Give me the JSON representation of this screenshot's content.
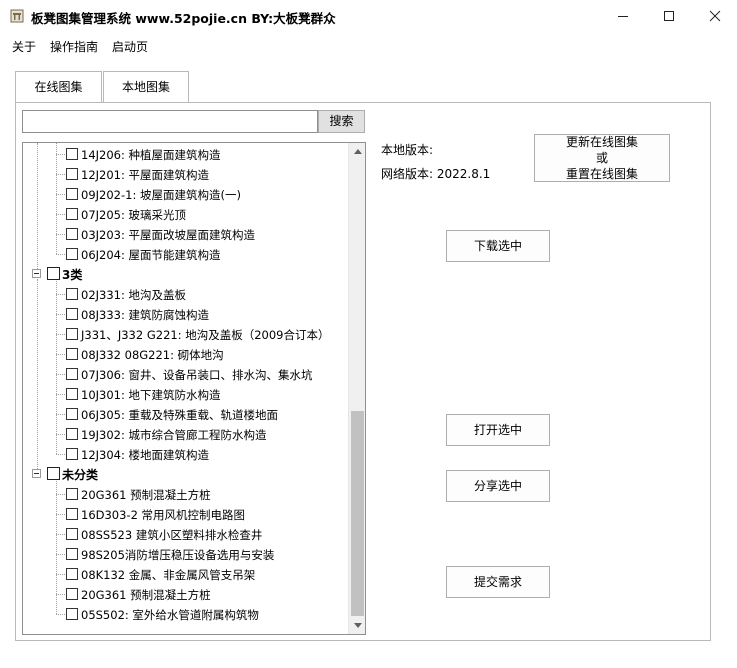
{
  "window": {
    "title": "板凳图集管理系统 www.52pojie.cn  BY:大板凳群众"
  },
  "menu": {
    "items": [
      {
        "label": "关于"
      },
      {
        "label": "操作指南"
      },
      {
        "label": "启动页"
      }
    ]
  },
  "tabs": [
    {
      "label": "在线图集",
      "active": false
    },
    {
      "label": "本地图集",
      "active": true
    }
  ],
  "search": {
    "value": "",
    "button_label": "搜索"
  },
  "tree": {
    "rows": [
      {
        "kind": "item",
        "label": "14J206: 种植屋面建筑构造"
      },
      {
        "kind": "item",
        "label": "12J201: 平屋面建筑构造"
      },
      {
        "kind": "item",
        "label": "09J202-1: 坡屋面建筑构造(一)"
      },
      {
        "kind": "item",
        "label": "07J205: 玻璃采光顶"
      },
      {
        "kind": "item",
        "label": "03J203: 平屋面改坡屋面建筑构造"
      },
      {
        "kind": "item",
        "label": "06J204: 屋面节能建筑构造"
      },
      {
        "kind": "group",
        "label": "3类"
      },
      {
        "kind": "item",
        "label": "02J331: 地沟及盖板"
      },
      {
        "kind": "item",
        "label": "08J333: 建筑防腐蚀构造"
      },
      {
        "kind": "item",
        "label": "J331、J332 G221: 地沟及盖板（2009合订本）"
      },
      {
        "kind": "item",
        "label": "08J332 08G221: 砌体地沟"
      },
      {
        "kind": "item",
        "label": "07J306: 窗井、设备吊装口、排水沟、集水坑"
      },
      {
        "kind": "item",
        "label": "10J301: 地下建筑防水构造"
      },
      {
        "kind": "item",
        "label": "06J305: 重载及特殊重载、轨道楼地面"
      },
      {
        "kind": "item",
        "label": "19J302: 城市综合管廊工程防水构造"
      },
      {
        "kind": "item",
        "label": "12J304: 楼地面建筑构造"
      },
      {
        "kind": "group",
        "label": "未分类"
      },
      {
        "kind": "item",
        "label": "20G361 预制混凝土方桩"
      },
      {
        "kind": "item",
        "label": "16D303-2 常用风机控制电路图"
      },
      {
        "kind": "item",
        "label": "08SS523 建筑小区塑料排水检查井"
      },
      {
        "kind": "item",
        "label": "98S205消防增压稳压设备选用与安装"
      },
      {
        "kind": "item",
        "label": "08K132 金属、非金属风管支吊架"
      },
      {
        "kind": "item",
        "label": "20G361 预制混凝土方桩"
      },
      {
        "kind": "item",
        "label": "05S502: 室外给水管道附属构筑物"
      }
    ]
  },
  "versions": {
    "local_label": "本地版本:",
    "net_label": "网络版本: 2022.8.1"
  },
  "buttons": {
    "update_line1": "更新在线图集",
    "update_line2": "或",
    "update_line3": "重置在线图集",
    "download": "下载选中",
    "open": "打开选中",
    "share": "分享选中",
    "submit": "提交需求"
  },
  "icons": {
    "app": "app-logo-icon",
    "minimize": "minimize-icon",
    "maximize": "maximize-icon",
    "close": "close-icon",
    "collapse": "collapse-icon",
    "scroll_up": "scroll-up-icon",
    "scroll_down": "scroll-down-icon"
  },
  "colors": {
    "panel_border": "#b9b9b9",
    "button_face": "#fdfdfd",
    "scroll_thumb": "#c1c1c1"
  }
}
